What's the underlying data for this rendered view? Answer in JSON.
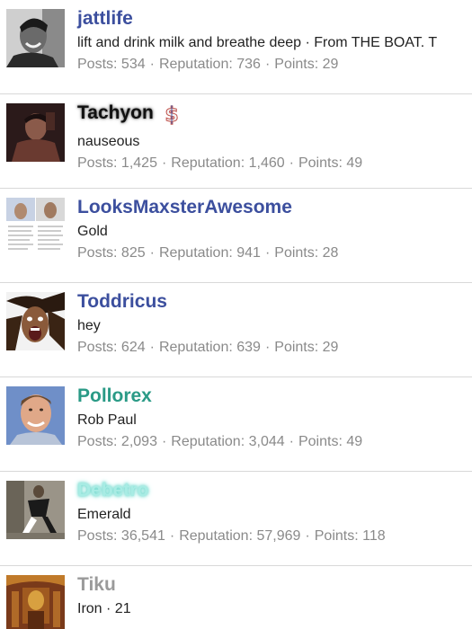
{
  "labels": {
    "posts": "Posts:",
    "reputation": "Reputation:",
    "points": "Points:",
    "separator": "·"
  },
  "members": [
    {
      "username": "jattlife",
      "tagline": "lift and drink milk and breathe deep · From THE BOAT. T",
      "posts": "534",
      "reputation": "736",
      "points": "29",
      "name_style": "blue",
      "avatar_icon": "man-smiling-portrait"
    },
    {
      "username": "Tachyon",
      "tagline": "nauseous",
      "posts": "1,425",
      "reputation": "1,460",
      "points": "49",
      "name_style": "dark-glow",
      "badge_icon": "dollar-icon",
      "avatar_icon": "dark-figure-portrait"
    },
    {
      "username": "LooksMaxsterAwesome",
      "tagline": "Gold",
      "posts": "825",
      "reputation": "941",
      "points": "28",
      "name_style": "blue",
      "avatar_icon": "document-collage"
    },
    {
      "username": "Toddricus",
      "tagline": "hey",
      "posts": "624",
      "reputation": "639",
      "points": "29",
      "name_style": "blue",
      "avatar_icon": "screaming-face-portrait"
    },
    {
      "username": "Pollorex",
      "tagline": "Rob Paul",
      "posts": "2,093",
      "reputation": "3,044",
      "points": "49",
      "name_style": "green",
      "avatar_icon": "smiling-man-portrait"
    },
    {
      "username": "Debetro",
      "tagline": "Emerald",
      "posts": "36,541",
      "reputation": "57,969",
      "points": "118",
      "name_style": "cyan-glow",
      "avatar_icon": "running-figure-photo"
    },
    {
      "username": "Tiku",
      "tagline": "Iron · 21",
      "name_style": "gray",
      "avatar_icon": "ornate-figure-portrait"
    }
  ],
  "colors": {
    "blue_name": "#3c4f9e",
    "green_name": "#2a9a86",
    "cyan_glow": "#a8ece4",
    "stats": "#8a8a8a",
    "divider": "#d8d8d8"
  }
}
